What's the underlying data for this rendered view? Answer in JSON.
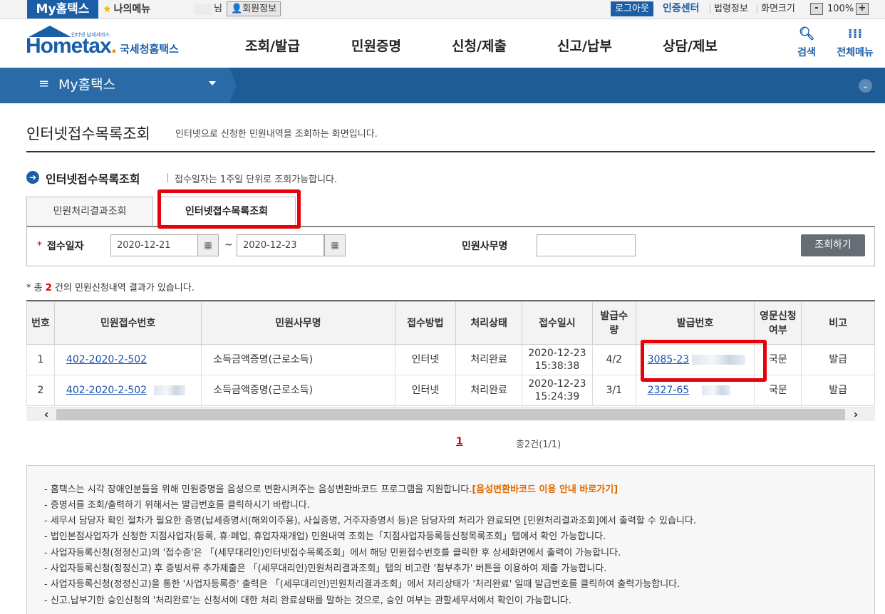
{
  "topbar": {
    "my_hometax": "My홈택스",
    "my_menu": "나의메뉴",
    "name_suffix": "님",
    "member_info": "회원정보",
    "logout": "로그아웃",
    "cert_center": "인증센터",
    "law_info": "법령정보",
    "screen_size": "화면크기",
    "zoom_minus": "-",
    "zoom_value": "100%",
    "zoom_plus": "+"
  },
  "header": {
    "logo_small": "인터넷 납세서비스",
    "logo_main_1": "Hom",
    "logo_main_2": "etax",
    "logo_dot": ".",
    "logo_kr": "국세청홈택스",
    "nav": [
      "조회/발급",
      "민원증명",
      "신청/제출",
      "신고/납부",
      "상담/제보"
    ],
    "search_label": "검색",
    "allmenu_label": "전체메뉴"
  },
  "subnav": {
    "title": "My홈택스"
  },
  "page": {
    "title": "인터넷접수목록조회",
    "desc": "인터넷으로 신청한 민원내역을 조회하는 화면입니다.",
    "section_title": "인터넷접수목록조회",
    "section_note": "접수일자는 1주일 단위로 조회가능합니다."
  },
  "tabs": [
    "민원처리결과조회",
    "인터넷접수목록조회"
  ],
  "search": {
    "date_label": "접수일자",
    "date_from": "2020-12-21",
    "date_to": "2020-12-23",
    "tilde": "~",
    "service_label": "민원사무명",
    "service_value": "",
    "button": "조회하기"
  },
  "result": {
    "prefix": "* 총 ",
    "count": "2",
    "suffix": " 건의 민원신청내역 결과가 있습니다."
  },
  "table": {
    "headers": [
      "번호",
      "민원접수번호",
      "민원사무명",
      "접수방법",
      "처리상태",
      "접수일시",
      "발급수량",
      "발급번호",
      "영문신청여부",
      "비고"
    ],
    "rows": [
      {
        "no": "1",
        "receipt": "402-2020-2-502",
        "service": "소득금액증명(근로소득)",
        "method": "인터넷",
        "status": "처리완료",
        "date": "2020-12-23",
        "time": "15:38:38",
        "qty": "4/2",
        "issue": "3085-23",
        "english": "국문",
        "note": "발급"
      },
      {
        "no": "2",
        "receipt": "402-2020-2-502",
        "service": "소득금액증명(근로소득)",
        "method": "인터넷",
        "status": "처리완료",
        "date": "2020-12-23",
        "time": "15:24:39",
        "qty": "3/1",
        "issue": "2327-65",
        "english": "국문",
        "note": "발급"
      }
    ]
  },
  "pager": {
    "current": "1",
    "total": "총2건(1/1)"
  },
  "notice": {
    "lines": [
      "- 홈택스는 시각 장애인분들을 위해 민원증명을 음성으로 변환시켜주는 음성변환바코드 프로그램을 지원합니다.",
      "- 증명서를 조회/출력하기 위해서는 발급번호를 클릭하시기 바랍니다.",
      "- 세무서 담당자 확인 절차가 필요한 증명(납세증명서(해외이주용), 사실증명, 거주자증명서 등)은 담당자의 처리가 완료되면 [민원처리결과조회]에서 출력할 수 있습니다.",
      "- 법인본점사업자가 신청한 지점사업자(등록, 휴·폐업, 휴업자재개업) 민원내역 조회는「지점사업자등록등신청목록조회」탭에서 확인 가능합니다.",
      "- 사업자등록신청(정정신고)의 '접수증'은 「(세무대리인)인터넷접수목록조회」에서 해당 민원접수번호를 클릭한 후 상세화면에서 출력이 가능합니다.",
      "- 사업자등록신청(정정신고) 후 증빙서류 추가제출은 「(세무대리인)민원처리결과조회」탭의 비고란 '첨부추가' 버튼을 이용하여 제출 가능합니다.",
      "- 사업자등록신청(정정신고)을 통한 '사업자등록증' 출력은 「(세무대리인)민원처리결과조회」에서 처리상태가 '처리완료' 일때 발급번호를 클릭하여 출력가능합니다.",
      "- 신고.납부기한 승인신청의 '처리완료'는 신청서에 대한 처리 완료상태를 말하는 것으로, 승인 여부는 관할세무서에서 확인이 가능합니다."
    ],
    "link": "[음성변환바코드 이용 안내 바로가기]"
  },
  "colors": {
    "brand": "#1a5ea8",
    "highlight": "#e8000a",
    "accent_orange": "#e06a00"
  }
}
